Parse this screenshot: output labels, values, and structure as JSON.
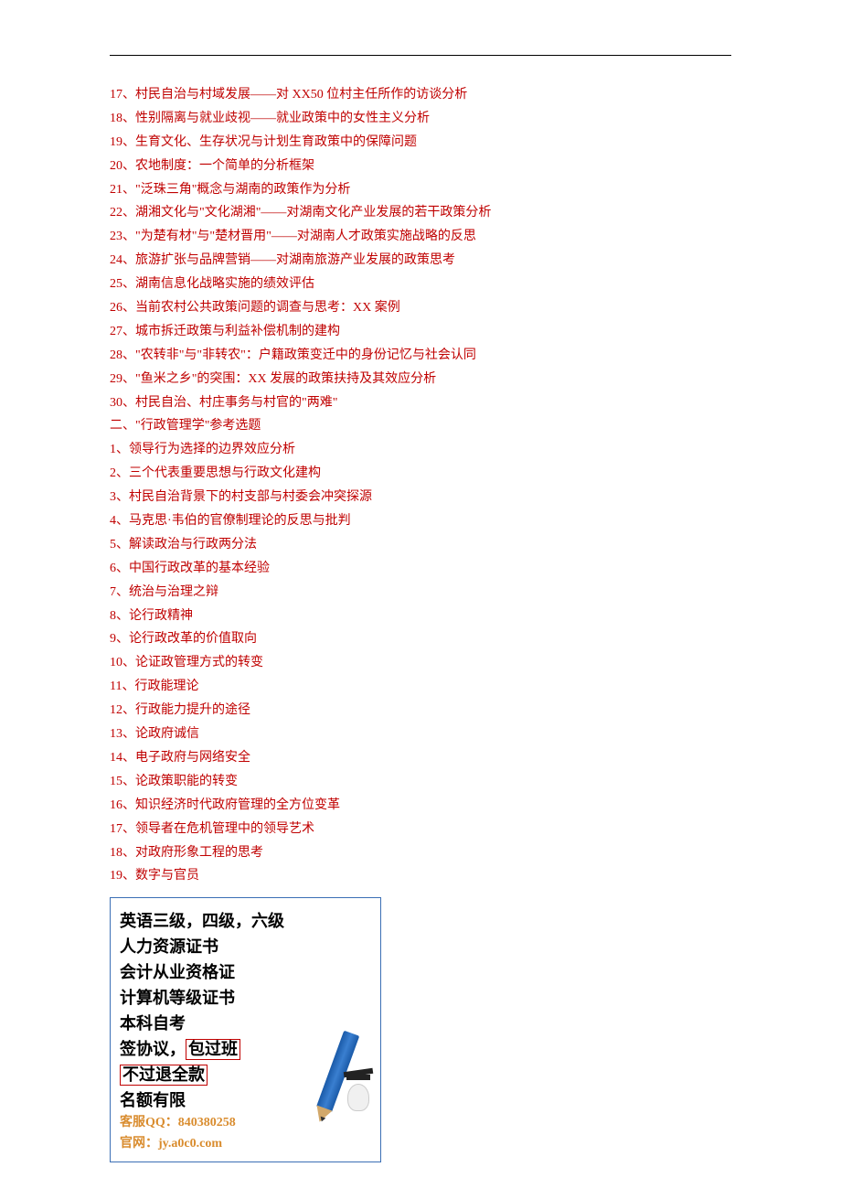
{
  "lines": [
    "17、村民自治与村域发展——对 XX50 位村主任所作的访谈分析",
    "18、性别隔离与就业歧视——就业政策中的女性主义分析",
    "19、生育文化、生存状况与计划生育政策中的保障问题",
    "20、农地制度：一个简单的分析框架",
    "21、\"泛珠三角\"概念与湖南的政策作为分析",
    "22、湖湘文化与\"文化湖湘\"——对湖南文化产业发展的若干政策分析",
    "23、\"为楚有材\"与\"楚材晋用\"——对湖南人才政策实施战略的反思",
    "24、旅游扩张与品牌营销——对湖南旅游产业发展的政策思考",
    "25、湖南信息化战略实施的绩效评估",
    "26、当前农村公共政策问题的调查与思考：XX 案例",
    "27、城市拆迁政策与利益补偿机制的建构",
    "28、\"农转非\"与\"非转农\"：户籍政策变迁中的身份记忆与社会认同",
    "29、\"鱼米之乡\"的突围：XX 发展的政策扶持及其效应分析",
    "30、村民自治、村庄事务与村官的\"两难\"",
    "二、\"行政管理学\"参考选题",
    "1、领导行为选择的边界效应分析",
    "2、三个代表重要思想与行政文化建构",
    "3、村民自治背景下的村支部与村委会冲突探源",
    "4、马克思·韦伯的官僚制理论的反思与批判",
    "5、解读政治与行政两分法",
    "6、中国行政改革的基本经验",
    "7、统治与治理之辩",
    "8、论行政精神",
    "9、论行政改革的价值取向",
    "10、论证政管理方式的转变",
    "11、行政能理论",
    "12、行政能力提升的途径",
    "13、论政府诚信",
    "14、电子政府与网络安全",
    "15、论政策职能的转变",
    "16、知识经济时代政府管理的全方位变革",
    "17、领导者在危机管理中的领导艺术",
    "18、对政府形象工程的思考",
    "19、数字与官员"
  ],
  "ad": {
    "l1": "英语三级，四级，六级",
    "l2": "人力资源证书",
    "l3": "会计从业资格证",
    "l4": "计算机等级证书",
    "l5": "本科自考",
    "l6a": "签协议，",
    "l6b": "包过班",
    "l7": "不过退全款",
    "l8": "名额有限",
    "qq_label": "客服QQ：",
    "qq_value": "840380258",
    "site_label": "官网：",
    "site_value": "jy.a0c0.com"
  }
}
